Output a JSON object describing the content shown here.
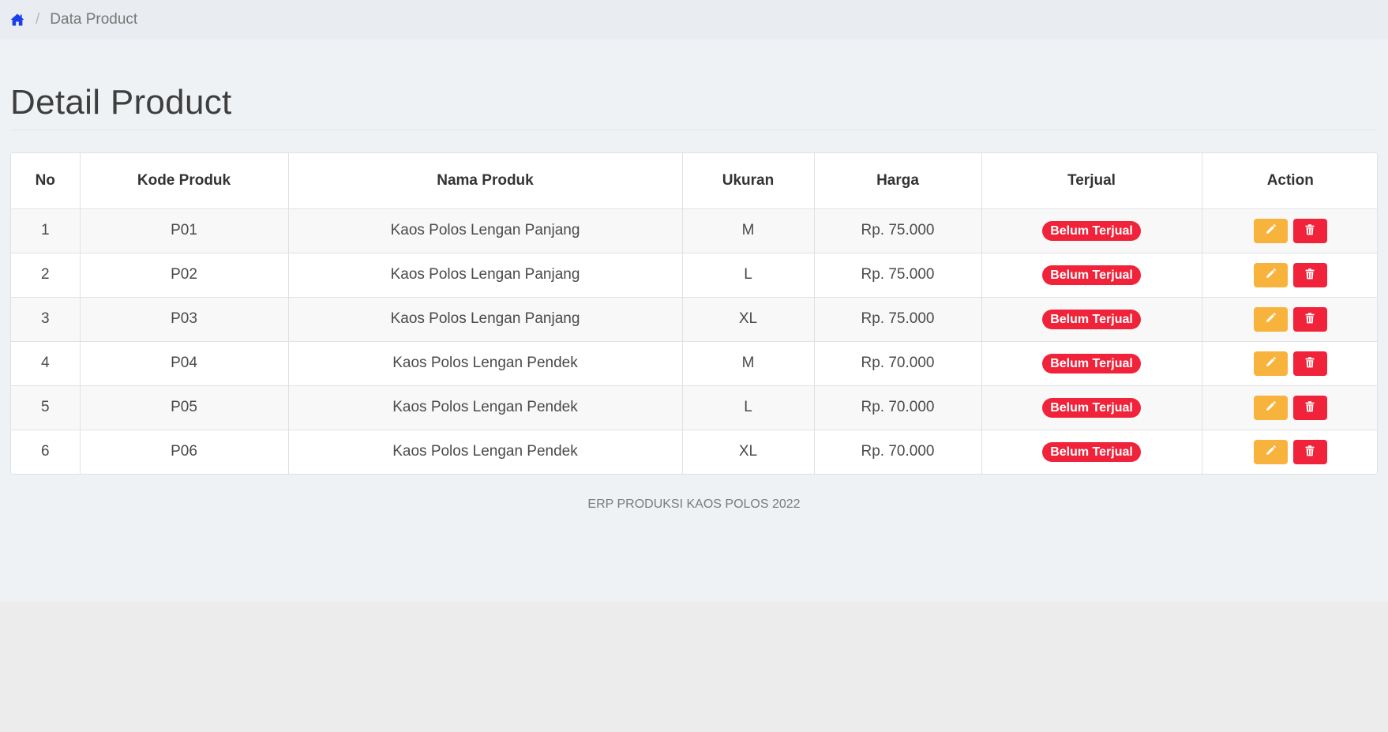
{
  "breadcrumb": {
    "current": "Data Product"
  },
  "page": {
    "title": "Detail Product"
  },
  "table": {
    "headers": [
      "No",
      "Kode Produk",
      "Nama Produk",
      "Ukuran",
      "Harga",
      "Terjual",
      "Action"
    ],
    "rows": [
      {
        "no": "1",
        "kode": "P01",
        "nama": "Kaos Polos Lengan Panjang",
        "ukuran": "M",
        "harga": "Rp. 75.000",
        "terjual": "Belum Terjual"
      },
      {
        "no": "2",
        "kode": "P02",
        "nama": "Kaos Polos Lengan Panjang",
        "ukuran": "L",
        "harga": "Rp. 75.000",
        "terjual": "Belum Terjual"
      },
      {
        "no": "3",
        "kode": "P03",
        "nama": "Kaos Polos Lengan Panjang",
        "ukuran": "XL",
        "harga": "Rp. 75.000",
        "terjual": "Belum Terjual"
      },
      {
        "no": "4",
        "kode": "P04",
        "nama": "Kaos Polos Lengan Pendek",
        "ukuran": "M",
        "harga": "Rp. 70.000",
        "terjual": "Belum Terjual"
      },
      {
        "no": "5",
        "kode": "P05",
        "nama": "Kaos Polos Lengan Pendek",
        "ukuran": "L",
        "harga": "Rp. 70.000",
        "terjual": "Belum Terjual"
      },
      {
        "no": "6",
        "kode": "P06",
        "nama": "Kaos Polos Lengan Pendek",
        "ukuran": "XL",
        "harga": "Rp. 70.000",
        "terjual": "Belum Terjual"
      }
    ],
    "row_icons": {
      "edit": "pencil-icon",
      "delete": "trash-icon"
    }
  },
  "footer": {
    "text": "ERP PRODUKSI KAOS POLOS 2022"
  },
  "icons": {
    "home": "home-icon"
  },
  "colors": {
    "accent": "#1a3ef0",
    "badge_danger": "#f0233a",
    "button_warning": "#f8b33d",
    "button_danger": "#f0233a"
  }
}
